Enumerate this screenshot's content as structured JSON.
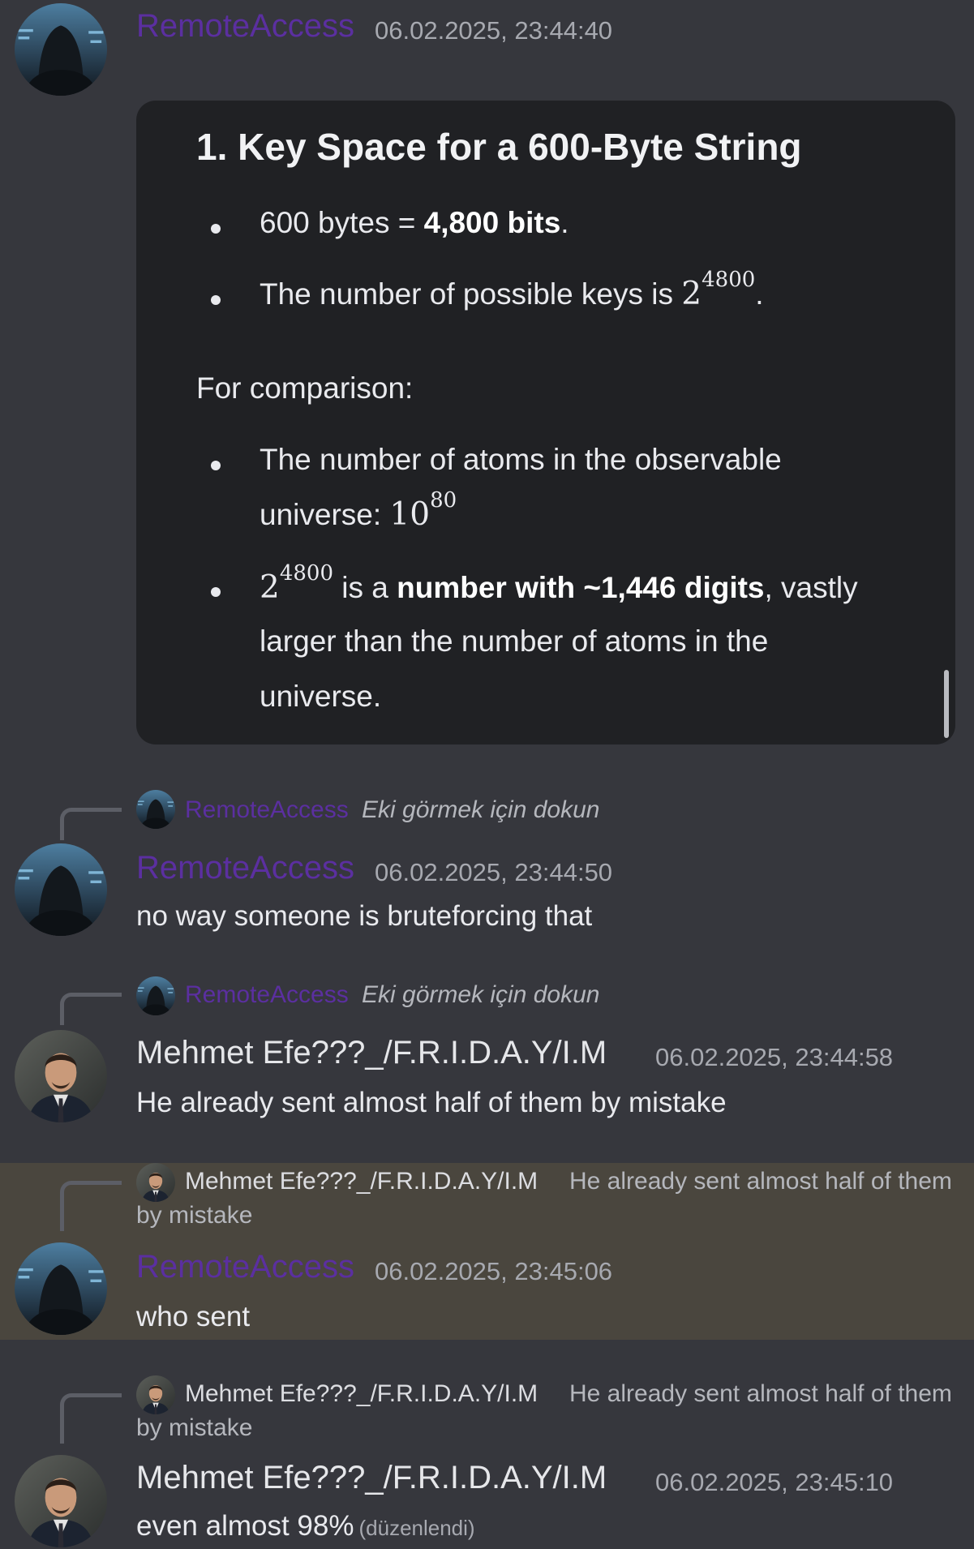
{
  "messages": {
    "m1": {
      "username": "RemoteAccess",
      "timestamp": "06.02.2025, 23:44:40",
      "card": {
        "title": "1. Key Space for a 600-Byte String",
        "bullet1_prefix": "600 bytes = ",
        "bullet1_bold": "4,800 bits",
        "bullet1_suffix": ".",
        "bullet2_prefix": "The number of possible keys is ",
        "bullet2_base": "2",
        "bullet2_exp": "4800",
        "bullet2_suffix": ".",
        "comparison": "For comparison:",
        "bullet3_line1": "The number of atoms in the observable",
        "bullet3_line2_prefix": "universe: ",
        "bullet3_base": "10",
        "bullet3_exp": "80",
        "bullet4_base": "2",
        "bullet4_exp": "4800",
        "bullet4_mid": " is a ",
        "bullet4_bold": "number with ~1,446 digits",
        "bullet4_end": ", vastly",
        "bullet4_line2": "larger than the number of atoms in the",
        "bullet4_line3": "universe."
      }
    },
    "m2": {
      "reply_name": "RemoteAccess",
      "reply_snippet": "Eki görmek için dokun",
      "username": "RemoteAccess",
      "timestamp": "06.02.2025, 23:44:50",
      "text": "no way someone is bruteforcing that"
    },
    "m3": {
      "reply_name": "RemoteAccess",
      "reply_snippet": "Eki görmek için dokun",
      "username": "Mehmet Efe???_/F.R.I.D.A.Y/I.M",
      "timestamp": "06.02.2025, 23:44:58",
      "text": "He already sent almost half of them by mistake"
    },
    "m4": {
      "reply_name": "Mehmet Efe???_/F.R.I.D.A.Y/I.M",
      "reply_snippet": "He already sent almost half of them",
      "reply_snippet_cont": "by mistake",
      "username": "RemoteAccess",
      "timestamp": "06.02.2025, 23:45:06",
      "text": "who sent"
    },
    "m5": {
      "reply_name": "Mehmet Efe???_/F.R.I.D.A.Y/I.M",
      "reply_snippet": "He already sent almost half of them",
      "reply_snippet_cont": "by mistake",
      "username": "Mehmet Efe???_/F.R.I.D.A.Y/I.M",
      "timestamp": "06.02.2025, 23:45:10",
      "text": "even almost 98%",
      "edited": "(düzenlendi)"
    }
  },
  "colors": {
    "background": "#36373d",
    "card": "#202124",
    "remote_username": "#5b2fa0",
    "highlight": "#4a463e",
    "timestamp": "#a7a9b0"
  },
  "icons": {
    "remote_avatar": "hooded-hacker-avatar",
    "mehmet_avatar": "man-in-suit-avatar"
  }
}
